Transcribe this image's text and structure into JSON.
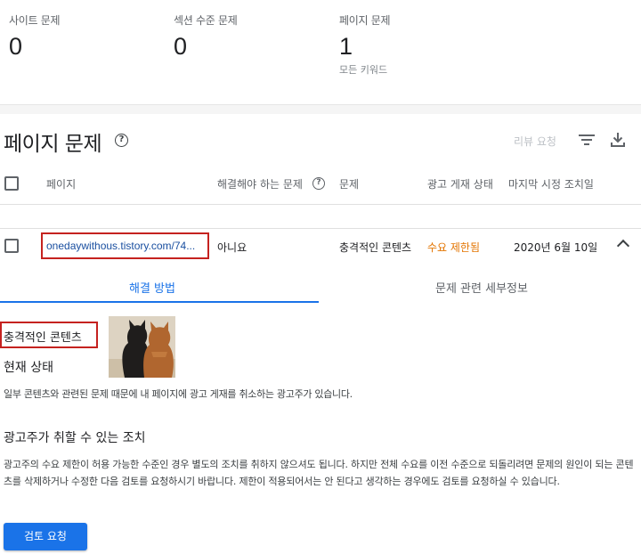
{
  "summary": {
    "site_issues": {
      "label": "사이트 문제",
      "value": "0"
    },
    "section_issues": {
      "label": "섹션 수준 문제",
      "value": "0"
    },
    "page_issues": {
      "label": "페이지 문제",
      "value": "1",
      "sub": "모든 키워드"
    }
  },
  "section": {
    "title": "페이지 문제",
    "review_label": "리뷰 요청"
  },
  "table": {
    "headers": [
      "페이지",
      "해결해야 하는 문제",
      "문제",
      "광고 게재 상태",
      "마지막 시정 조치일"
    ],
    "row": {
      "url": "onedaywithous.tistory.com/74...",
      "must_fix": "아니요",
      "issue": "충격적인 콘텐츠",
      "status": "수요 제한됨",
      "date": "2020년 6월 10일"
    }
  },
  "tabs": [
    "해결 방법",
    "문제 관련 세부정보"
  ],
  "detail": {
    "title": "충격적인 콘텐츠",
    "current_status_heading": "현재 상태",
    "current_status_text": "일부 콘텐츠와 관련된 문제 때문에 내 페이지에 광고 게재를 취소하는 광고주가 있습니다.",
    "actions_heading": "광고주가 취할 수 있는 조치",
    "actions_text": "광고주의 수요 제한이 허용 가능한 수준인 경우 별도의 조치를 취하지 않으셔도 됩니다. 하지만 전체 수요를 이전 수준으로 되돌리려면 문제의 원인이 되는 콘텐츠를 삭제하거나 수정한 다음 검토를 요청하시기 바랍니다. 제한이 적용되어서는 안 된다고 생각하는 경우에도 검토를 요청하실 수 있습니다.",
    "button_label": "검토 요청"
  },
  "colors": {
    "accent": "#1a73e8",
    "highlight_box": "#c5221f",
    "status_orange": "#e37400"
  },
  "icons": [
    "help-icon",
    "filter-icon",
    "download-icon",
    "chevron-up-icon"
  ]
}
